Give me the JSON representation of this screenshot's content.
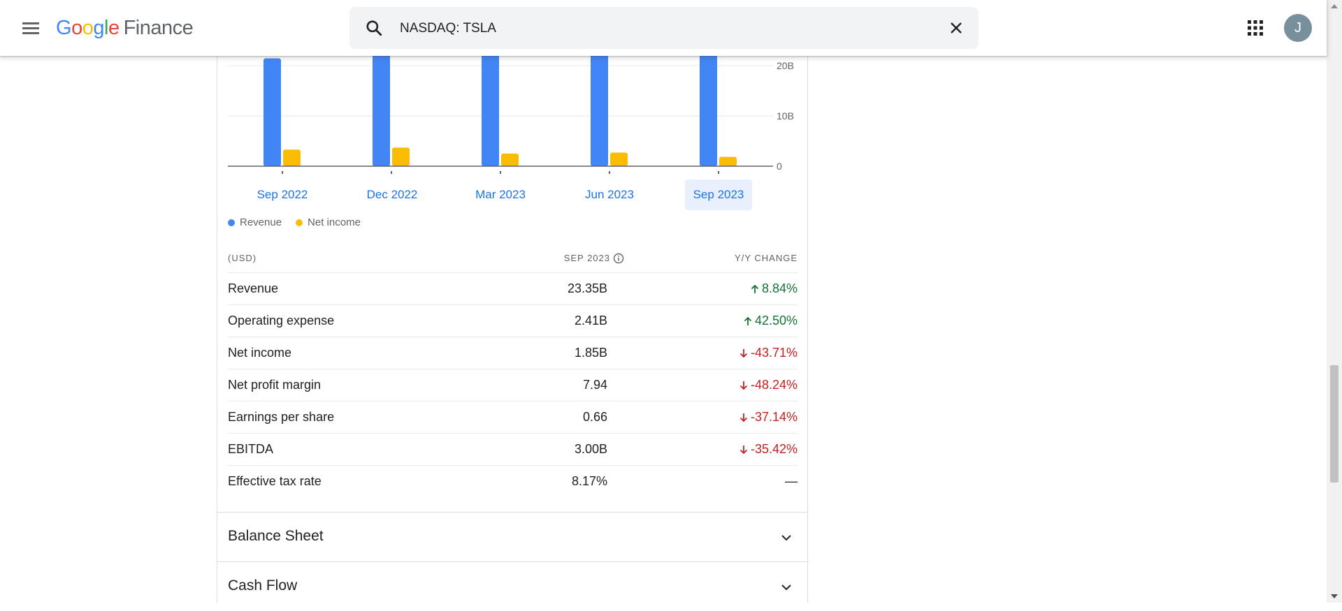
{
  "header": {
    "logo_google": [
      "G",
      "o",
      "o",
      "g",
      "l",
      "e"
    ],
    "logo_product": "Finance",
    "search": {
      "value": "NASDAQ: TSLA"
    },
    "avatar_initial": "J",
    "icons": [
      "menu-icon",
      "search-icon",
      "close-icon",
      "apps-icon"
    ]
  },
  "chart_data": {
    "type": "bar",
    "categories": [
      "Sep 2022",
      "Dec 2022",
      "Mar 2023",
      "Jun 2023",
      "Sep 2023"
    ],
    "series": [
      {
        "name": "Revenue",
        "color": "#4285f4",
        "values": [
          21.45,
          24.32,
          23.33,
          24.93,
          23.35
        ]
      },
      {
        "name": "Net income",
        "color": "#fbbc04",
        "values": [
          3.29,
          3.69,
          2.51,
          2.7,
          1.85
        ]
      }
    ],
    "y_ticks": [
      "20B",
      "10B",
      "0"
    ],
    "y_tick_values": [
      20,
      10,
      0
    ],
    "selected_category": "Sep 2023"
  },
  "periods": [
    "Sep 2022",
    "Dec 2022",
    "Mar 2023",
    "Jun 2023",
    "Sep 2023"
  ],
  "legend": [
    {
      "label": "Revenue",
      "color": "#4285f4"
    },
    {
      "label": "Net income",
      "color": "#fbbc04"
    }
  ],
  "table": {
    "col_label": "(USD)",
    "col_period": "SEP 2023",
    "col_change": "Y/Y CHANGE",
    "rows": [
      {
        "label": "Revenue",
        "value": "23.35B",
        "change": "8.84%",
        "direction": "up"
      },
      {
        "label": "Operating expense",
        "value": "2.41B",
        "change": "42.50%",
        "direction": "up"
      },
      {
        "label": "Net income",
        "value": "1.85B",
        "change": "-43.71%",
        "direction": "down"
      },
      {
        "label": "Net profit margin",
        "value": "7.94",
        "change": "-48.24%",
        "direction": "down"
      },
      {
        "label": "Earnings per share",
        "value": "0.66",
        "change": "-37.14%",
        "direction": "down"
      },
      {
        "label": "EBITDA",
        "value": "3.00B",
        "change": "-35.42%",
        "direction": "down"
      },
      {
        "label": "Effective tax rate",
        "value": "8.17%",
        "change": "—",
        "direction": "none"
      }
    ]
  },
  "sections": [
    "Balance Sheet",
    "Cash Flow"
  ],
  "colors": {
    "up": "#137333",
    "down": "#c5221f",
    "accent": "#1a73e8"
  }
}
